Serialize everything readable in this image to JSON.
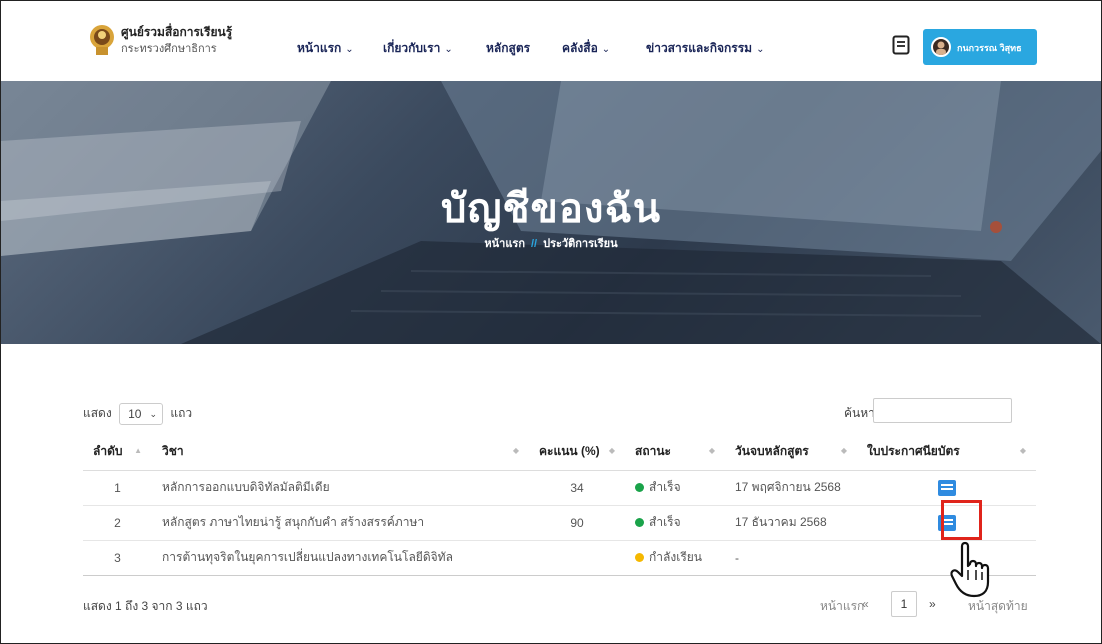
{
  "header": {
    "brand_line1": "ศูนย์รวมสื่อการเรียนรู้",
    "brand_line2": "กระทรวงศึกษาธิการ",
    "nav": [
      {
        "label": "หน้าแรก",
        "has_caret": true
      },
      {
        "label": "เกี่ยวกับเรา",
        "has_caret": true
      },
      {
        "label": "หลักสูตร",
        "has_caret": false
      },
      {
        "label": "คลังสื่อ",
        "has_caret": true
      },
      {
        "label": "ข่าวสารและกิจกรรม",
        "has_caret": true
      }
    ],
    "caret": "⌄",
    "user_name": "กนกวรรณ วิสุทธ",
    "accent_color": "#2aa7e0"
  },
  "hero": {
    "title": "บัญชีของฉัน",
    "breadcrumb_home": "หน้าแรก",
    "breadcrumb_sep": "//",
    "breadcrumb_current": "ประวัติการเรียน"
  },
  "table_controls": {
    "show_label": "แสดง",
    "page_length": "10",
    "rows_label": "แถว",
    "search_label": "ค้นหา:"
  },
  "table": {
    "columns": [
      "ลำดับ",
      "วิชา",
      "คะแนน (%)",
      "สถานะ",
      "วันจบหลักสูตร",
      "ใบประกาศนียบัตร"
    ],
    "rows": [
      {
        "no": "1",
        "course": "หลักการออกแบบดิจิทัลมัลติมีเดีย",
        "score": "34",
        "status": "สำเร็จ",
        "status_color": "#1aa34a",
        "end_date": "17 พฤศจิกายน 2568",
        "certificate": "certificate-icon"
      },
      {
        "no": "2",
        "course": "หลักสูตร ภาษาไทยน่ารู้ สนุกกับคำ สร้างสรรค์ภาษา",
        "score": "90",
        "status": "สำเร็จ",
        "status_color": "#1aa34a",
        "end_date": "17 ธันวาคม 2568",
        "certificate": "certificate-icon"
      },
      {
        "no": "3",
        "course": "การต้านทุจริตในยุคการเปลี่ยนแปลงทางเทคโนโลยีดิจิทัล",
        "score": "",
        "status": "กำลังเรียน",
        "status_color": "#f5b800",
        "end_date": "-",
        "certificate": ""
      }
    ]
  },
  "footer": {
    "info": "แสดง 1 ถึง 3 จาก 3 แถว",
    "first": "หน้าแรก",
    "prev": "«",
    "page": "1",
    "next": "»",
    "last": "หน้าสุดท้าย"
  }
}
